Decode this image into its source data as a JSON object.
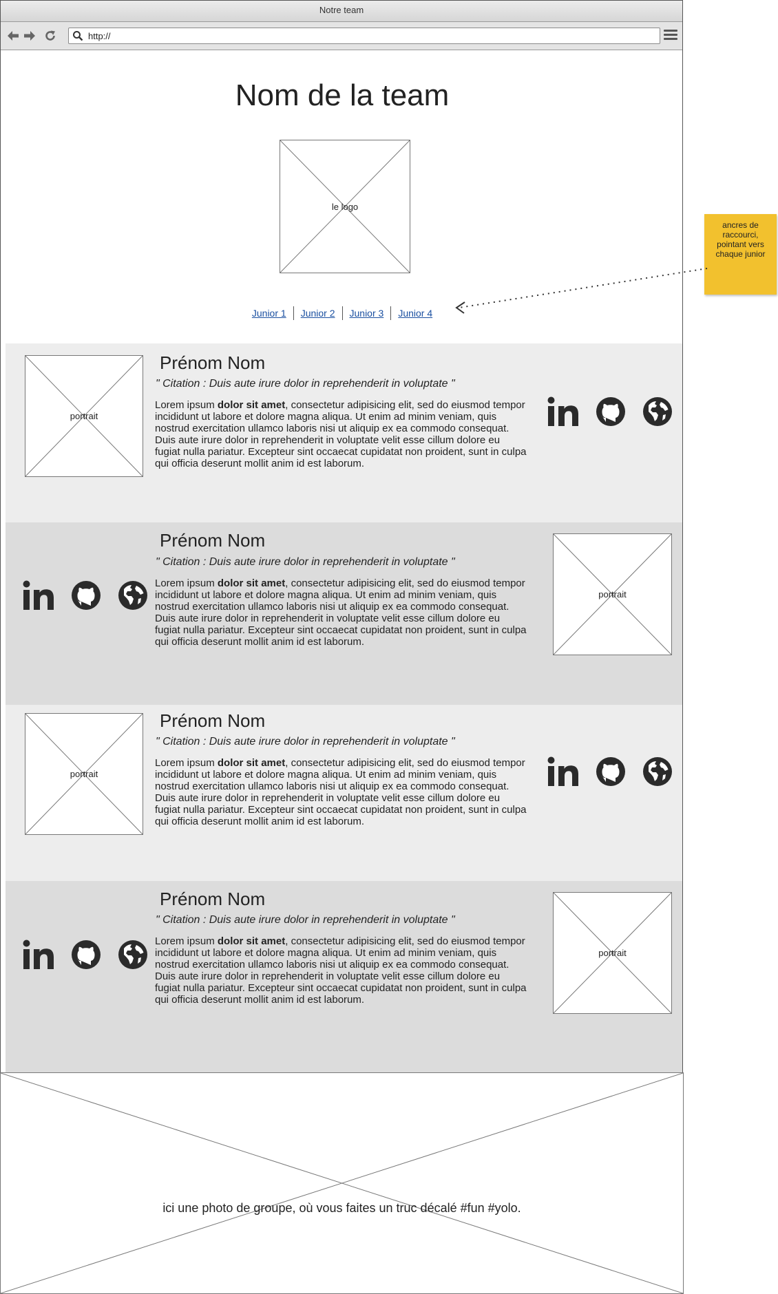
{
  "window": {
    "title": "Notre team"
  },
  "browser": {
    "url": "http://"
  },
  "header": {
    "title": "Nom de la team",
    "logo_label": "le logo",
    "anchors": [
      "Junior 1",
      "Junior 2",
      "Junior 3",
      "Junior 4"
    ]
  },
  "members": [
    {
      "name": "Prénom Nom",
      "quote": "\" Citation : Duis aute irure dolor in reprehenderit in voluptate \"",
      "bio_start": "Lorem ipsum ",
      "bio_bold": "dolor sit amet",
      "bio_rest": ", consectetur adipisicing elit, sed do eiusmod tempor incididunt ut labore et dolore magna aliqua. Ut enim ad minim veniam, quis nostrud exercitation ullamco laboris nisi ut aliquip ex ea commodo consequat. Duis aute irure dolor in reprehenderit in voluptate velit esse cillum dolore eu fugiat nulla pariatur. Excepteur sint occaecat cupidatat non proident, sunt in culpa qui officia deserunt mollit anim id est laborum.",
      "portrait_label": "portrait"
    },
    {
      "name": "Prénom Nom",
      "quote": "\" Citation : Duis aute irure dolor in reprehenderit in voluptate \"",
      "bio_start": "Lorem ipsum ",
      "bio_bold": "dolor sit amet",
      "bio_rest": ", consectetur adipisicing elit, sed do eiusmod tempor incididunt ut labore et dolore magna aliqua. Ut enim ad minim veniam, quis nostrud exercitation ullamco laboris nisi ut aliquip ex ea commodo consequat. Duis aute irure dolor in reprehenderit in voluptate velit esse cillum dolore eu fugiat nulla pariatur. Excepteur sint occaecat cupidatat non proident, sunt in culpa qui officia deserunt mollit anim id est laborum.",
      "portrait_label": "portrait"
    },
    {
      "name": "Prénom Nom",
      "quote": "\" Citation : Duis aute irure dolor in reprehenderit in voluptate \"",
      "bio_start": "Lorem ipsum ",
      "bio_bold": "dolor sit amet",
      "bio_rest": ", consectetur adipisicing elit, sed do eiusmod tempor incididunt ut labore et dolore magna aliqua. Ut enim ad minim veniam, quis nostrud exercitation ullamco laboris nisi ut aliquip ex ea commodo consequat. Duis aute irure dolor in reprehenderit in voluptate velit esse cillum dolore eu fugiat nulla pariatur. Excepteur sint occaecat cupidatat non proident, sunt in culpa qui officia deserunt mollit anim id est laborum.",
      "portrait_label": "portrait"
    },
    {
      "name": "Prénom Nom",
      "quote": "\" Citation : Duis aute irure dolor in reprehenderit in voluptate \"",
      "bio_start": "Lorem ipsum ",
      "bio_bold": "dolor sit amet",
      "bio_rest": ", consectetur adipisicing elit, sed do eiusmod tempor incididunt ut labore et dolore magna aliqua. Ut enim ad minim veniam, quis nostrud exercitation ullamco laboris nisi ut aliquip ex ea commodo consequat. Duis aute irure dolor in reprehenderit in voluptate velit esse cillum dolore eu fugiat nulla pariatur. Excepteur sint occaecat cupidatat non proident, sunt in culpa qui officia deserunt mollit anim id est laborum.",
      "portrait_label": "portrait"
    }
  ],
  "social_icons": [
    "linkedin-icon",
    "github-icon",
    "globe-icon"
  ],
  "group_photo": {
    "label": "ici une photo de groupe, où vous faites un truc décalé #fun #yolo."
  },
  "annotation": {
    "text": "ancres de raccourci, pointant vers chaque junior"
  },
  "colors": {
    "light_section": "#ededed",
    "dark_section": "#dcdcdc",
    "sticky_note": "#f2c12e",
    "link": "#1a4fa0",
    "icon": "#2b2b2b"
  }
}
